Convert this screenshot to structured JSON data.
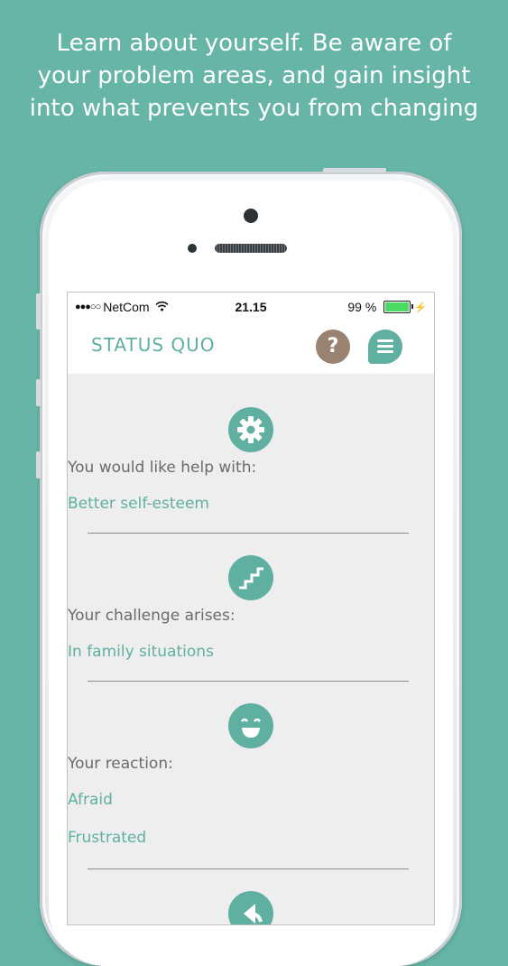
{
  "headline": {
    "line1": "Learn about yourself. Be aware of",
    "line2": "your problem areas, and gain insight",
    "line3": "into what prevents you from changing"
  },
  "statusbar": {
    "carrier": "NetCom",
    "time": "21.15",
    "battery_text": "99 %",
    "battery_level": 0.99
  },
  "app": {
    "title": "STATUS QUO",
    "help_label": "?"
  },
  "sections": [
    {
      "label": "You would like help with:",
      "values": [
        "Better self-esteem"
      ]
    },
    {
      "label": "Your challenge arises:",
      "values": [
        "In family situations"
      ]
    },
    {
      "label": "Your reaction:",
      "values": [
        "Afraid",
        "Frustrated"
      ]
    }
  ],
  "colors": {
    "background": "#66b5a7",
    "accent": "#5fb0a0",
    "help_button": "#9a8270",
    "battery": "#4cd964"
  },
  "icons": {
    "section1": "gear-icon",
    "section2": "stairs-icon",
    "section3": "smiley-icon",
    "section4": "back-arrow-icon",
    "help": "question-icon",
    "menu": "menu-icon"
  }
}
